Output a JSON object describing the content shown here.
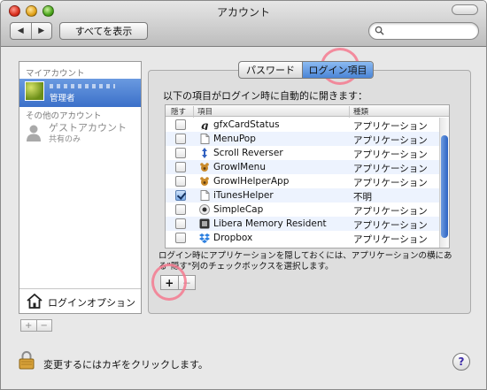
{
  "window": {
    "title": "アカウント"
  },
  "toolbar": {
    "back_glyph": "◀",
    "forward_glyph": "▶",
    "show_all_label": "すべてを表示",
    "search_placeholder": ""
  },
  "sidebar": {
    "my_account_header": "マイアカウント",
    "current_user_role": "管理者",
    "other_accounts_header": "その他のアカウント",
    "guest_name": "ゲストアカウント",
    "guest_subtitle": "共有のみ",
    "login_options_label": "ログインオプション",
    "add_glyph": "+",
    "remove_glyph": "−"
  },
  "tabs": [
    {
      "label": "パスワード",
      "selected": false
    },
    {
      "label": "ログイン項目",
      "selected": true
    }
  ],
  "login_items": {
    "intro": "以下の項目がログイン時に自動的に開きます：",
    "columns": {
      "hide": "隠す",
      "item": "項目",
      "kind": "種類"
    },
    "rows": [
      {
        "hide": false,
        "name": "gfxCardStatus",
        "kind": "アプリケーション",
        "icon": "gfx-icon"
      },
      {
        "hide": false,
        "name": "MenuPop",
        "kind": "アプリケーション",
        "icon": "document-icon"
      },
      {
        "hide": false,
        "name": "Scroll Reverser",
        "kind": "アプリケーション",
        "icon": "scroll-icon"
      },
      {
        "hide": false,
        "name": "GrowlMenu",
        "kind": "アプリケーション",
        "icon": "growl-icon"
      },
      {
        "hide": false,
        "name": "GrowlHelperApp",
        "kind": "アプリケーション",
        "icon": "growl-icon"
      },
      {
        "hide": true,
        "name": "iTunesHelper",
        "kind": "不明",
        "icon": "document-icon"
      },
      {
        "hide": false,
        "name": "SimpleCap",
        "kind": "アプリケーション",
        "icon": "camera-icon"
      },
      {
        "hide": false,
        "name": "Libera Memory Resident",
        "kind": "アプリケーション",
        "icon": "memory-icon"
      },
      {
        "hide": false,
        "name": "Dropbox",
        "kind": "アプリケーション",
        "icon": "dropbox-icon"
      }
    ],
    "hint": "ログイン時にアプリケーションを隠しておくには、アプリケーションの横にある\"隠す\"列のチェックボックスを選択します。",
    "add_glyph": "+",
    "remove_glyph": "−"
  },
  "footer": {
    "lock_text": "変更するにはカギをクリックします。",
    "help_glyph": "?"
  },
  "colors": {
    "selection_blue": "#3b70c9",
    "tab_selected": "#4a84d6",
    "annotation_pink": "#f47a8f"
  }
}
